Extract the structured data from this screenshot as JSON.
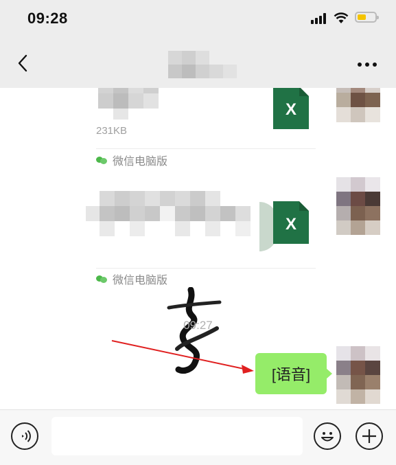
{
  "status_bar": {
    "time": "09:28",
    "battery_color": "#f5c400"
  },
  "nav": {
    "back_icon": "chevron-left-icon",
    "more_icon": "more-dots-icon"
  },
  "messages": [
    {
      "type": "file",
      "size": "231KB",
      "file_icon": "excel-icon",
      "file_icon_label": "X",
      "source": "微信电脑版"
    },
    {
      "type": "file",
      "file_icon": "excel-icon",
      "file_icon_label": "X",
      "source": "微信电脑版"
    }
  ],
  "timestamp": "09:27",
  "voice_message": {
    "text": "[语音]",
    "bubble_color": "#95ec69"
  },
  "input_bar": {
    "voice_icon": "voice-toggle-icon",
    "emoji_icon": "emoji-icon",
    "plus_icon": "plus-icon"
  },
  "annotation_color": "#e02020"
}
